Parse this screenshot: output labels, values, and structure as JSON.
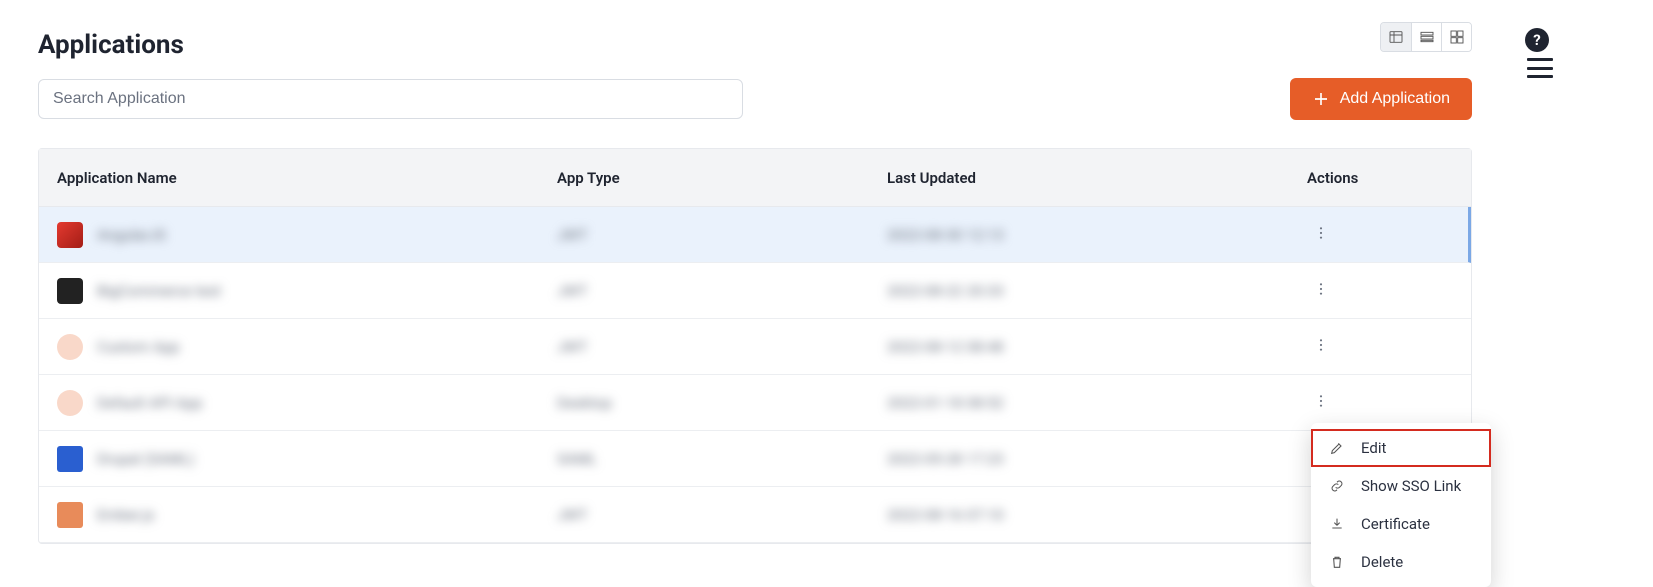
{
  "page": {
    "title": "Applications"
  },
  "search": {
    "placeholder": "Search Application"
  },
  "buttons": {
    "add": "Add Application"
  },
  "table": {
    "headers": {
      "name": "Application Name",
      "type": "App Type",
      "updated": "Last Updated",
      "actions": "Actions"
    },
    "rows": [
      {
        "icon": "red",
        "name": "AngularJS",
        "type": "JWT",
        "updated": "2022-08-30 12:13"
      },
      {
        "icon": "dark",
        "name": "BigCommerce test",
        "type": "JWT",
        "updated": "2022-08-22 20:33"
      },
      {
        "icon": "peach",
        "name": "Custom App",
        "type": "JWT",
        "updated": "2022-08-12 08:48"
      },
      {
        "icon": "peach2",
        "name": "Default API App",
        "type": "Desktop",
        "updated": "2022-01-18 08:52"
      },
      {
        "icon": "blue",
        "name": "Drupal (SAML)",
        "type": "SAML",
        "updated": "2022-05-28 17:23"
      },
      {
        "icon": "orange",
        "name": "Ember.js",
        "type": "JWT",
        "updated": "2022-08-16 07:10"
      }
    ]
  },
  "menu": {
    "edit": "Edit",
    "sso": "Show SSO Link",
    "cert": "Certificate",
    "delete": "Delete"
  }
}
